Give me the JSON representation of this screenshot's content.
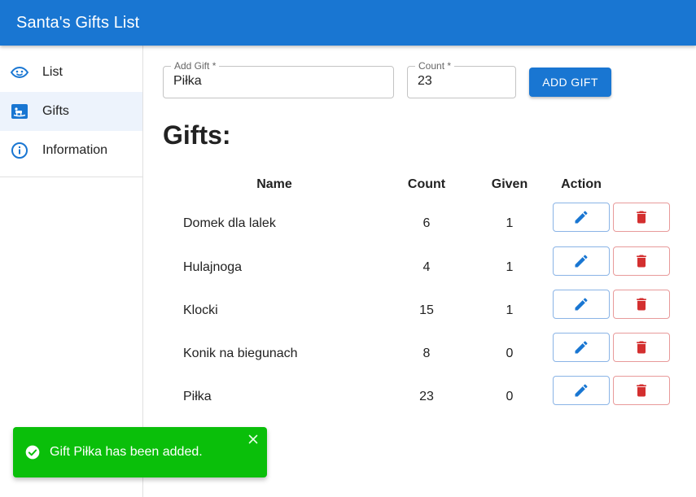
{
  "app": {
    "title": "Santa's Gifts List"
  },
  "sidebar": {
    "items": [
      {
        "label": "List",
        "icon": "face-icon",
        "active": false
      },
      {
        "label": "Gifts",
        "icon": "rocking-horse-icon",
        "active": true
      },
      {
        "label": "Information",
        "icon": "info-icon",
        "active": false
      }
    ]
  },
  "form": {
    "gift_label": "Add Gift *",
    "gift_value": "Piłka",
    "count_label": "Count *",
    "count_value": "23",
    "add_button": "ADD GIFT"
  },
  "gifts": {
    "title": "Gifts:",
    "columns": {
      "name": "Name",
      "count": "Count",
      "given": "Given",
      "action": "Action"
    },
    "rows": [
      {
        "name": "Domek dla lalek",
        "count": "6",
        "given": "1"
      },
      {
        "name": "Hulajnoga",
        "count": "4",
        "given": "1"
      },
      {
        "name": "Klocki",
        "count": "15",
        "given": "1"
      },
      {
        "name": "Konik na biegunach",
        "count": "8",
        "given": "0"
      },
      {
        "name": "Piłka",
        "count": "23",
        "given": "0"
      }
    ]
  },
  "snackbar": {
    "message": "Gift Piłka has been added."
  },
  "colors": {
    "primary": "#1976d2",
    "danger": "#d32f2f",
    "success": "#0abf0a",
    "active_nav_bg": "#edf3fc"
  }
}
